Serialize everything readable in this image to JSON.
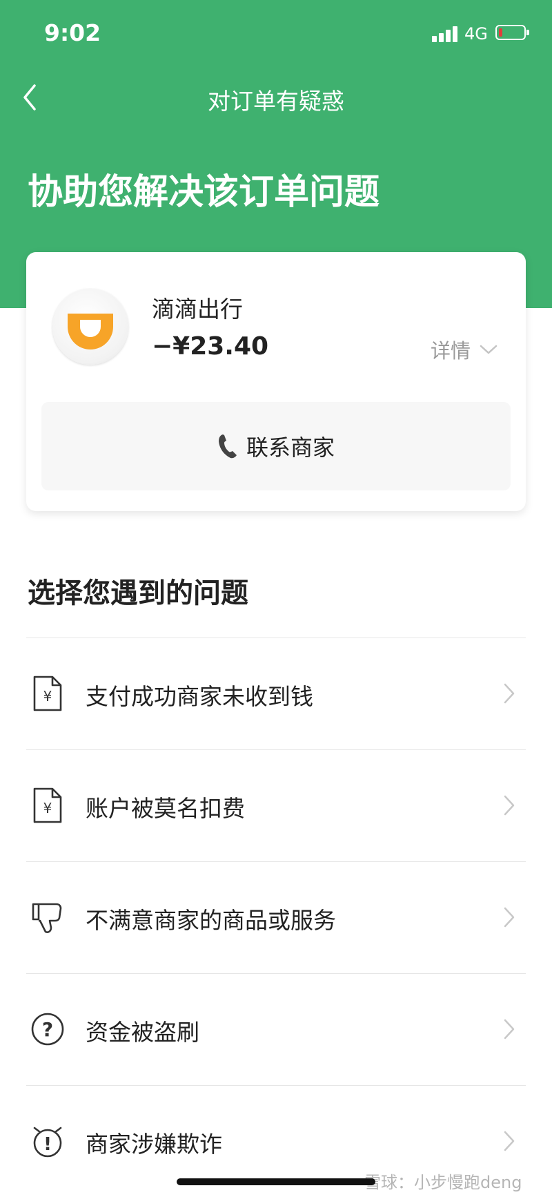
{
  "status_bar": {
    "time": "9:02",
    "network": "4G",
    "battery_level": 0.15
  },
  "nav": {
    "title": "对订单有疑惑",
    "back_icon": "chevron-left-icon"
  },
  "hero": {
    "title": "协助您解决该订单问题"
  },
  "order_card": {
    "merchant_name": "滴滴出行",
    "amount": "−¥23.40",
    "detail_label": "详情",
    "contact_label": "联系商家",
    "logo_icon": "didi-logo-icon",
    "phone_icon": "phone-icon"
  },
  "issues": {
    "title": "选择您遇到的问题",
    "items": [
      {
        "label": "支付成功商家未收到钱",
        "icon": "yuan-document-icon"
      },
      {
        "label": "账户被莫名扣费",
        "icon": "yuan-document-icon"
      },
      {
        "label": "不满意商家的商品或服务",
        "icon": "thumbs-down-icon"
      },
      {
        "label": "资金被盗刷",
        "icon": "question-circle-icon"
      },
      {
        "label": "商家涉嫌欺诈",
        "icon": "alarm-exclamation-icon"
      }
    ]
  },
  "watermark": "雪球：小步慢跑deng",
  "colors": {
    "primary_green": "#3fb16f",
    "didi_orange": "#f7a428",
    "battery_low": "#e23c3c"
  }
}
